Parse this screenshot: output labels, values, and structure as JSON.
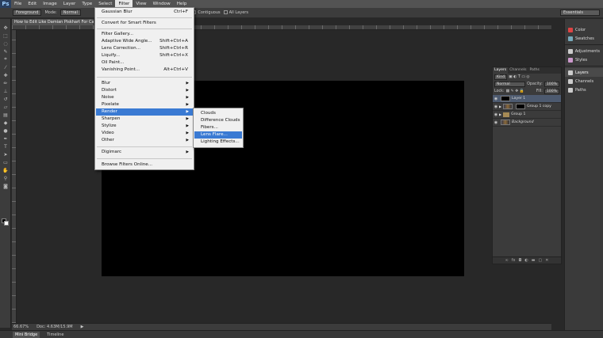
{
  "app": {
    "logo": "Ps"
  },
  "menubar": {
    "items": [
      "File",
      "Edit",
      "Image",
      "Layer",
      "Type",
      "Select",
      "Filter",
      "View",
      "Window",
      "Help"
    ],
    "active_index": 6
  },
  "options_bar": {
    "foreground_dropdown": "Foreground",
    "mode_label": "Mode:",
    "mode_value": "Normal",
    "contiguous_label": "Contiguous",
    "all_layers_label": "All Layers",
    "partial_label": "lias"
  },
  "workspace_switcher": {
    "value": "Essentials"
  },
  "document": {
    "tab_title": "How to Edit Like Damian Piskhart For Car Ex"
  },
  "filter_menu": {
    "items": [
      {
        "label": "Gaussian Blur",
        "shortcut": "Ctrl+F"
      },
      {
        "label": "Convert for Smart Filters",
        "shortcut": ""
      },
      {
        "label": "Filter Gallery...",
        "shortcut": ""
      },
      {
        "label": "Adaptive Wide Angle...",
        "shortcut": "Shift+Ctrl+A"
      },
      {
        "label": "Lens Correction...",
        "shortcut": "Shift+Ctrl+R"
      },
      {
        "label": "Liquify...",
        "shortcut": "Shift+Ctrl+X"
      },
      {
        "label": "Oil Paint...",
        "shortcut": ""
      },
      {
        "label": "Vanishing Point...",
        "shortcut": "Alt+Ctrl+V"
      },
      {
        "label": "Blur",
        "shortcut": ""
      },
      {
        "label": "Distort",
        "shortcut": ""
      },
      {
        "label": "Noise",
        "shortcut": ""
      },
      {
        "label": "Pixelate",
        "shortcut": ""
      },
      {
        "label": "Render",
        "shortcut": ""
      },
      {
        "label": "Sharpen",
        "shortcut": ""
      },
      {
        "label": "Stylize",
        "shortcut": ""
      },
      {
        "label": "Video",
        "shortcut": ""
      },
      {
        "label": "Other",
        "shortcut": ""
      },
      {
        "label": "Digimarc",
        "shortcut": ""
      },
      {
        "label": "Browse Filters Online...",
        "shortcut": ""
      }
    ],
    "highlighted": "Render"
  },
  "render_submenu": {
    "items": [
      "Clouds",
      "Difference Clouds",
      "Fibers...",
      "Lens Flare...",
      "Lighting Effects..."
    ],
    "highlighted": "Lens Flare..."
  },
  "dock": {
    "items": [
      {
        "label": "Color",
        "icon": "color-icon",
        "color": "#d44"
      },
      {
        "label": "Swatches",
        "icon": "swatches-icon",
        "color": "#7ab"
      },
      {
        "label": "Adjustments",
        "icon": "adjustments-icon",
        "color": "#ccc"
      },
      {
        "label": "Styles",
        "icon": "styles-icon",
        "color": "#c9c"
      },
      {
        "label": "Layers",
        "icon": "layers-icon",
        "color": "#ccc"
      },
      {
        "label": "Channels",
        "icon": "channels-icon",
        "color": "#ccc"
      },
      {
        "label": "Paths",
        "icon": "paths-icon",
        "color": "#ccc"
      }
    ]
  },
  "layers_panel": {
    "tabs": [
      "Layers",
      "Channels",
      "Paths"
    ],
    "filter_kind": "Kind",
    "blend_mode": "Normal",
    "opacity_label": "Opacity:",
    "opacity_value": "100%",
    "lock_label": "Lock:",
    "fill_label": "Fill:",
    "fill_value": "100%",
    "layers": [
      {
        "name": "Layer 1",
        "type": "black",
        "selected": true
      },
      {
        "name": "Group 1 copy",
        "type": "photo-group",
        "selected": false
      },
      {
        "name": "Group 1",
        "type": "group",
        "selected": false
      },
      {
        "name": "Background",
        "type": "photo",
        "selected": false,
        "italic": true
      }
    ]
  },
  "status_bar": {
    "zoom": "66.67%",
    "doc_info": "Doc: 4.63M/15.9M"
  },
  "bottom_tabs": [
    "Mini Bridge",
    "Timeline"
  ]
}
